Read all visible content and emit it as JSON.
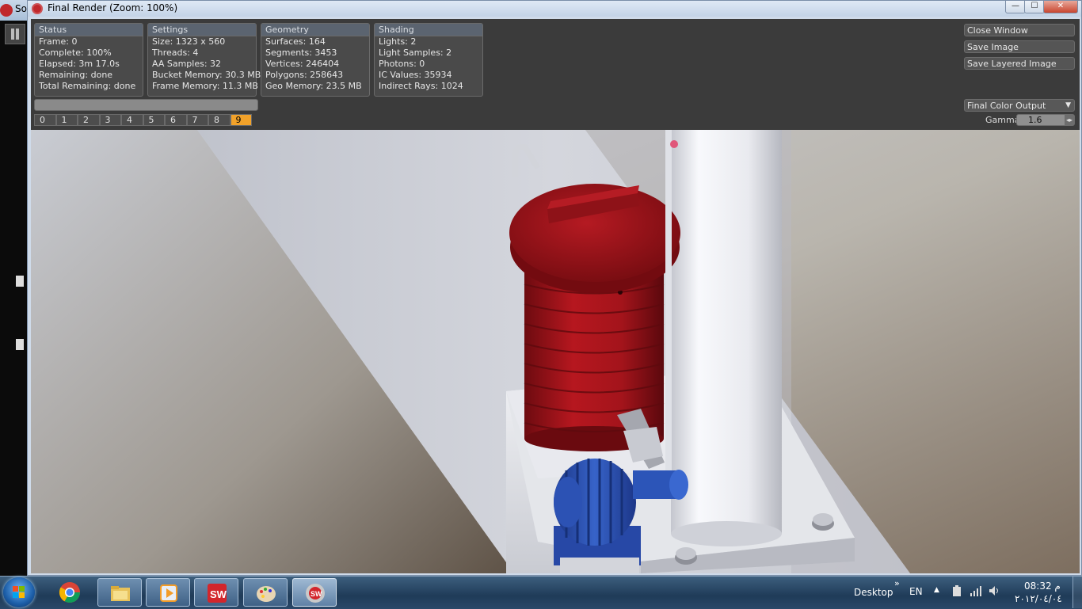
{
  "background_app": {
    "title_fragment": "So"
  },
  "window": {
    "title": "Final Render (Zoom: 100%)",
    "controls": {
      "minimize": "—",
      "maximize": "☐",
      "close": "✕"
    }
  },
  "panels": [
    {
      "header": "Status",
      "lines": [
        "Frame: 0",
        "Complete: 100%",
        "Elapsed: 3m 17.0s",
        "Remaining: done",
        "Total Remaining: done"
      ]
    },
    {
      "header": "Settings",
      "lines": [
        "Size: 1323 x 560",
        "Threads: 4",
        "AA Samples: 32",
        "Bucket Memory: 30.3 MB",
        "Frame Memory: 11.3 MB"
      ]
    },
    {
      "header": "Geometry",
      "lines": [
        "Surfaces: 164",
        "Segments: 3453",
        "Vertices: 246404",
        "Polygons: 258643",
        "Geo Memory: 23.5 MB"
      ]
    },
    {
      "header": "Shading",
      "lines": [
        "Lights: 2",
        "Light Samples: 2",
        "Photons: 0",
        "IC Values: 35934",
        "Indirect Rays: 1024"
      ]
    }
  ],
  "progress": 1.0,
  "frames": [
    "0",
    "1",
    "2",
    "3",
    "4",
    "5",
    "6",
    "7",
    "8",
    "9"
  ],
  "active_frame": "9",
  "buttons": {
    "close_window": "Close Window",
    "save_image": "Save Image",
    "save_layered_image": "Save Layered Image"
  },
  "output_select": {
    "value": "Final Color Output",
    "arrow": "▼"
  },
  "gamma": {
    "label": "Gamma",
    "value": "1.6",
    "spin": "◂▸"
  },
  "taskbar": {
    "items": [
      "chrome",
      "explorer",
      "media-player",
      "solidworks",
      "paint",
      "photoview-render"
    ],
    "desktop_label": "Desktop",
    "chevron": "»",
    "language": "EN",
    "time": "08:32 م",
    "date": "٢٠١٢/٠٤/٠٤"
  },
  "colors": {
    "accent_frame": "#f2a22a",
    "panel_bg": "#3b3b3b",
    "box_header": "#5b6470",
    "tank_red": "#a3141b",
    "gear_blue": "#2a4fb0"
  }
}
